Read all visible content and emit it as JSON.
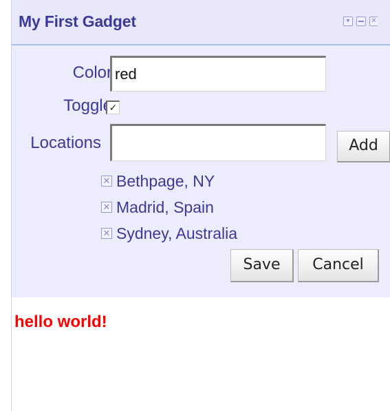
{
  "gadget": {
    "title": "My First Gadget",
    "buttons": {
      "menu": "▾",
      "close": "✕"
    }
  },
  "settings": {
    "color_label": "Color",
    "color_value": "red",
    "toggle_label": "Toggle",
    "toggle_checked": true,
    "toggle_mark": "✓",
    "locations_label": "Locations",
    "locations_input_value": "",
    "add_label": "Add",
    "locations": [
      {
        "name": "Bethpage, NY"
      },
      {
        "name": "Madrid, Spain"
      },
      {
        "name": "Sydney, Australia"
      }
    ],
    "remove_mark": "✕",
    "save_label": "Save",
    "cancel_label": "Cancel"
  },
  "content": {
    "message": "hello world!",
    "message_color": "#ff0000"
  },
  "colors": {
    "title": "#3b3a98",
    "settings_bg": "#ececfc",
    "titlebar_border": "#a9bde6"
  }
}
